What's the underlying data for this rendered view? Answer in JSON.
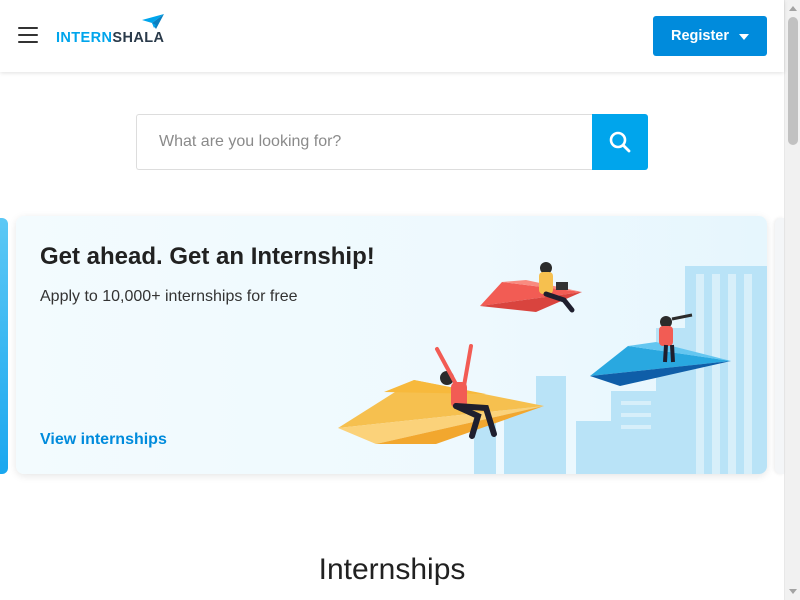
{
  "header": {
    "menu_icon": "hamburger-menu-icon",
    "logo": {
      "part1": "INTERN",
      "part2": "SHALA",
      "icon": "paper-plane-icon"
    },
    "register_label": "Register"
  },
  "search": {
    "placeholder": "What are you looking for?",
    "value": "",
    "button_icon": "search-icon"
  },
  "banner": {
    "title": "Get ahead. Get an Internship!",
    "subtitle": "Apply to 10,000+ internships for free",
    "link_label": "View internships"
  },
  "sections": {
    "internships_title": "Internships"
  },
  "colors": {
    "brand_blue": "#00a5ec",
    "button_blue": "#008bdc",
    "text_dark": "#212121"
  }
}
